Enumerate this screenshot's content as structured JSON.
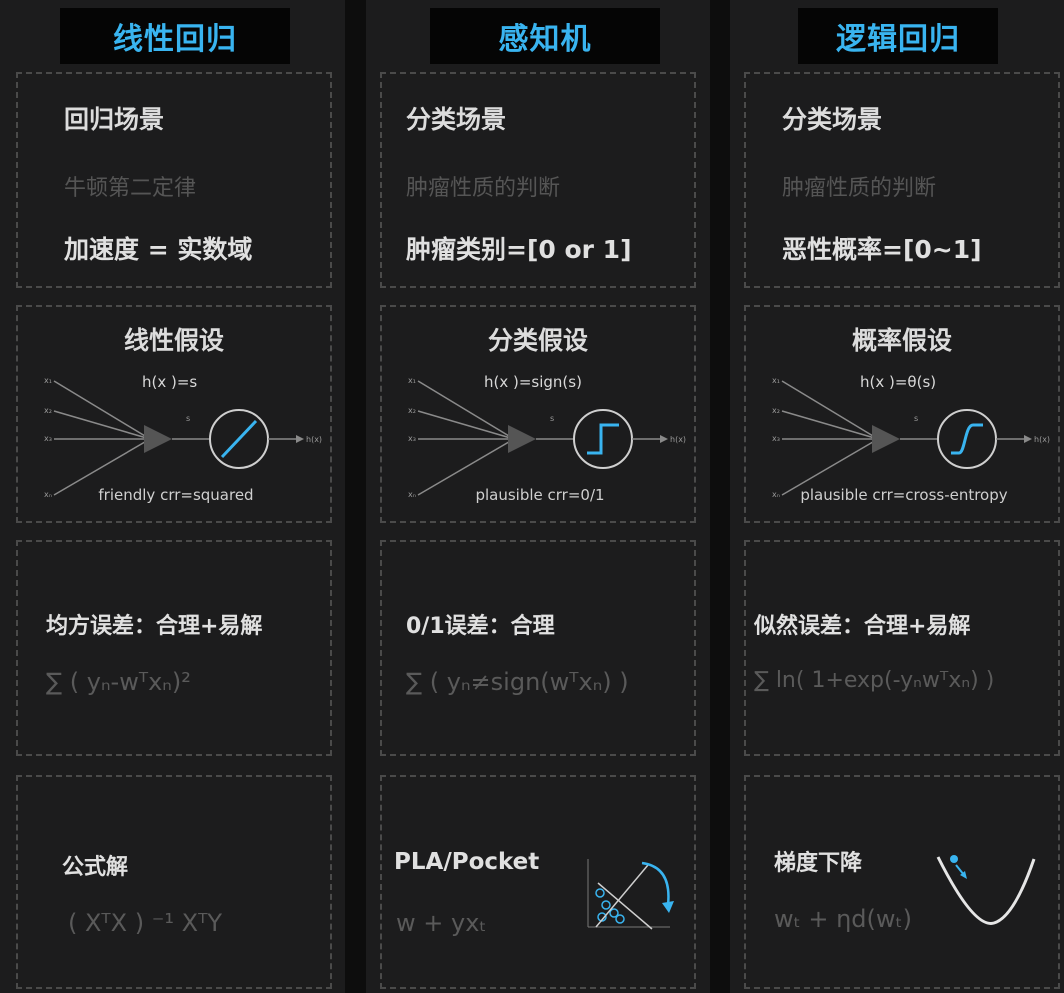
{
  "columns": [
    {
      "title": "线性回归",
      "scenario": {
        "heading": "回归场景",
        "example": "牛顿第二定律",
        "target": "加速度 = 实数域"
      },
      "hypothesis": {
        "heading": "线性假设",
        "formula": "h(x )=s",
        "err_note": "friendly crr=squared"
      },
      "error": {
        "heading": "均方误差：合理+易解",
        "formula": "∑ ( yₙ-wᵀxₙ)²"
      },
      "solve": {
        "heading": "公式解",
        "formula": "( XᵀX ) ⁻¹ XᵀY"
      }
    },
    {
      "title": "感知机",
      "scenario": {
        "heading": "分类场景",
        "example": "肿瘤性质的判断",
        "target": "肿瘤类别=[0 or 1]"
      },
      "hypothesis": {
        "heading": "分类假设",
        "formula": "h(x )=sign(s)",
        "err_note": "plausible crr=0/1"
      },
      "error": {
        "heading": "0/1误差：合理",
        "formula": "∑ ( yₙ≠sign(wᵀxₙ) )"
      },
      "solve": {
        "heading": "PLA/Pocket",
        "formula": "w + yxₜ"
      }
    },
    {
      "title": "逻辑回归",
      "scenario": {
        "heading": "分类场景",
        "example": "肿瘤性质的判断",
        "target": "恶性概率=[0~1]"
      },
      "hypothesis": {
        "heading": "概率假设",
        "formula": "h(x )=θ(s)",
        "err_note": "plausible crr=cross-entropy"
      },
      "error": {
        "heading": "似然误差：合理+易解",
        "formula": "∑ ln( 1+exp(-yₙwᵀxₙ) )"
      },
      "solve": {
        "heading": "梯度下降",
        "formula": "wₜ + ηd(wₜ)"
      }
    }
  ],
  "diagram_labels": {
    "inputs": [
      "x₁",
      "x₂",
      "x₃",
      "xₙ"
    ],
    "sum": "s",
    "output": "h(x)"
  },
  "colors": {
    "accent": "#39b4f0",
    "bg": "#1c1c1d",
    "dim_text": "#5a5a5a"
  }
}
